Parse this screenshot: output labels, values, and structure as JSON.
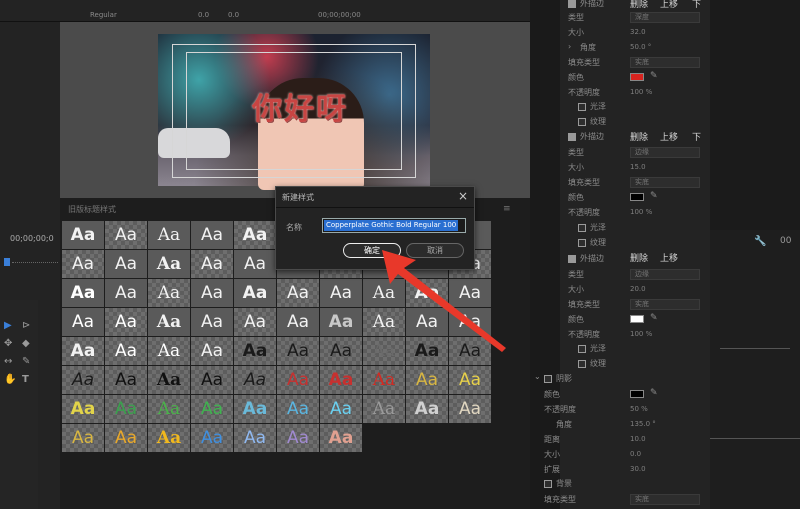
{
  "topbar": {
    "font_value": "Regular",
    "tracking": "0.0",
    "kerning": "0.0",
    "timecode": "00;00;00;00"
  },
  "monitor": {
    "overlay_text": "你好呀"
  },
  "timeline": {
    "timecode": "00;00;00;0"
  },
  "styles_panel": {
    "label": "旧版标题样式",
    "tiles": [
      {
        "t": "Aa",
        "c": "#f2f2f2"
      },
      {
        "t": "Aa",
        "c": "#f2f2f2"
      },
      {
        "t": "Aa",
        "c": "#f2f2f2"
      },
      {
        "t": "Aa",
        "c": "#f2f2f2"
      },
      {
        "t": "Aa",
        "c": "#f2f2f2"
      },
      {
        "t": "",
        "c": "#f2f2f2"
      },
      {
        "t": "",
        "c": "#f2f2f2"
      },
      {
        "t": "",
        "c": "#f2f2f2"
      },
      {
        "t": "",
        "c": "#f2f2f2"
      },
      {
        "t": "",
        "c": "#f2f2f2"
      },
      {
        "t": "Aa",
        "c": "#f2f2f2"
      },
      {
        "t": "Aa",
        "c": "#f2f2f2"
      },
      {
        "t": "Aa",
        "c": "#f2f2f2"
      },
      {
        "t": "Aa",
        "c": "#f2f2f2"
      },
      {
        "t": "Aa",
        "c": "#f2f2f2"
      },
      {
        "t": "Aa",
        "c": "#f2f2f2"
      },
      {
        "t": "Aa",
        "c": "#f2f2f2"
      },
      {
        "t": "Aa",
        "c": "#f2f2f2"
      },
      {
        "t": "Aa",
        "c": "#f2f2f2"
      },
      {
        "t": "Aa",
        "c": "#f2f2f2"
      },
      {
        "t": "Aa",
        "c": "#ffffff"
      },
      {
        "t": "Aa",
        "c": "#f2f2f2"
      },
      {
        "t": "Aa",
        "c": "#f2f2f2"
      },
      {
        "t": "Aa",
        "c": "#f2f2f2"
      },
      {
        "t": "Aa",
        "c": "#f2f2f2"
      },
      {
        "t": "Aa",
        "c": "#f2f2f2"
      },
      {
        "t": "Aa",
        "c": "#f2f2f2"
      },
      {
        "t": "Aa",
        "c": "#f2f2f2"
      },
      {
        "t": "Aa",
        "c": "#f2f2f2"
      },
      {
        "t": "Aa",
        "c": "#f2f2f2"
      },
      {
        "t": "Aa",
        "c": "#ffffff"
      },
      {
        "t": "Aa",
        "c": "#ffffff"
      },
      {
        "t": "Aa",
        "c": "#f2f2f2"
      },
      {
        "t": "Aa",
        "c": "#f2f2f2"
      },
      {
        "t": "Aa",
        "c": "#f2f2f2"
      },
      {
        "t": "Aa",
        "c": "#f2f2f2"
      },
      {
        "t": "Aa",
        "c": "#c8c8c8"
      },
      {
        "t": "Aa",
        "c": "#f2f2f2"
      },
      {
        "t": "Aa",
        "c": "#f2f2f2"
      },
      {
        "t": "Aa",
        "c": "#f2f2f2"
      },
      {
        "t": "Aa",
        "c": "#f2f2f2"
      },
      {
        "t": "Aa",
        "c": "#ffffff"
      },
      {
        "t": "Aa",
        "c": "#ffffff"
      },
      {
        "t": "Aa",
        "c": "#f2f2f2"
      },
      {
        "t": "Aa",
        "c": "#1a1a1a"
      },
      {
        "t": "Aa",
        "c": "#1a1a1a"
      },
      {
        "t": "Aa",
        "c": "#1a1a1a"
      },
      {
        "t": "Aa",
        "c": "#6a6a6a"
      },
      {
        "t": "Aa",
        "c": "#1a1a1a"
      },
      {
        "t": "Aa",
        "c": "#1a1a1a"
      },
      {
        "t": "Aa",
        "c": "#1a1a1a"
      },
      {
        "t": "Aa",
        "c": "#111111"
      },
      {
        "t": "Aa",
        "c": "#111111"
      },
      {
        "t": "Aa",
        "c": "#111111"
      },
      {
        "t": "Aa",
        "c": "#1a1a1a"
      },
      {
        "t": "Aa",
        "c": "#c8302f"
      },
      {
        "t": "Aa",
        "c": "#c8302f"
      },
      {
        "t": "Aa",
        "c": "#d42a22"
      },
      {
        "t": "Aa",
        "c": "#d8b642"
      },
      {
        "t": "Aa",
        "c": "#e6d04a"
      },
      {
        "t": "Aa",
        "c": "#e2d44a"
      },
      {
        "t": "Aa",
        "c": "#3aa14d"
      },
      {
        "t": "Aa",
        "c": "#4bb14a"
      },
      {
        "t": "Aa",
        "c": "#3fb34f"
      },
      {
        "t": "Aa",
        "c": "#6ab9d9"
      },
      {
        "t": "Aa",
        "c": "#5ab5e0"
      },
      {
        "t": "Aa",
        "c": "#6ad0f0"
      },
      {
        "t": "Aa",
        "c": "#9a9a9a"
      },
      {
        "t": "Aa",
        "c": "#d0d0d0"
      },
      {
        "t": "Aa",
        "c": "#e0d6c0"
      },
      {
        "t": "Aa",
        "c": "#d8b642"
      },
      {
        "t": "Aa",
        "c": "#e8a82a"
      },
      {
        "t": "Aa",
        "c": "#f0b81e"
      },
      {
        "t": "Aa",
        "c": "#3f8fe0"
      },
      {
        "t": "Aa",
        "c": "#8fb8f0"
      },
      {
        "t": "Aa",
        "c": "#a08ad0"
      },
      {
        "t": "Aa",
        "c": "#e0a090"
      }
    ]
  },
  "properties": {
    "section1": {
      "checkbox_label": "外描边",
      "delete": "删除",
      "move_up": "上移",
      "move_down": "下",
      "type_label": "类型",
      "type_value": "深度",
      "size_label": "大小",
      "size_value": "32.0",
      "angle_label": "角度",
      "angle_value": "50.0 °",
      "fill_label": "填充类型",
      "fill_value": "实底",
      "color_label": "颜色",
      "color_hex": "#d8241f",
      "opacity_label": "不透明度",
      "opacity_value": "100 %",
      "sheen_label": "光泽",
      "texture_label": "纹理"
    },
    "section2": {
      "checkbox_label": "外描边",
      "delete": "删除",
      "move_up": "上移",
      "move_down": "下",
      "type_label": "类型",
      "type_value": "边缘",
      "size_label": "大小",
      "size_value": "15.0",
      "fill_label": "填充类型",
      "fill_value": "实底",
      "color_label": "颜色",
      "color_hex": "#000000",
      "opacity_label": "不透明度",
      "opacity_value": "100 %",
      "sheen_label": "光泽",
      "texture_label": "纹理"
    },
    "section3": {
      "checkbox_label": "外描边",
      "delete": "删除",
      "move_up": "上移",
      "type_label": "类型",
      "type_value": "边缘",
      "size_label": "大小",
      "size_value": "20.0",
      "fill_label": "填充类型",
      "fill_value": "实底",
      "color_label": "颜色",
      "color_hex": "#ffffff",
      "opacity_label": "不透明度",
      "opacity_value": "100 %",
      "sheen_label": "光泽",
      "texture_label": "纹理"
    },
    "shadow": {
      "checkbox_label": "阴影",
      "color_label": "颜色",
      "color_hex": "#000000",
      "opacity_label": "不透明度",
      "opacity_value": "50 %",
      "angle_label": "角度",
      "angle_value": "135.0 °",
      "distance_label": "距离",
      "distance_value": "10.0",
      "size_label": "大小",
      "size_value": "0.0",
      "spread_label": "扩展",
      "spread_value": "30.0"
    },
    "background": {
      "checkbox_label": "背景",
      "fill_label": "填充类型",
      "fill_value": "实底"
    }
  },
  "dialog": {
    "title": "新建样式",
    "name_label": "名称",
    "name_value": "Copperplate Gothic Bold Regular 100",
    "ok_label": "确定",
    "cancel_label": "取消"
  },
  "colors": {
    "accent_arrow": "#e8382a",
    "selection": "#2a6fd1"
  }
}
